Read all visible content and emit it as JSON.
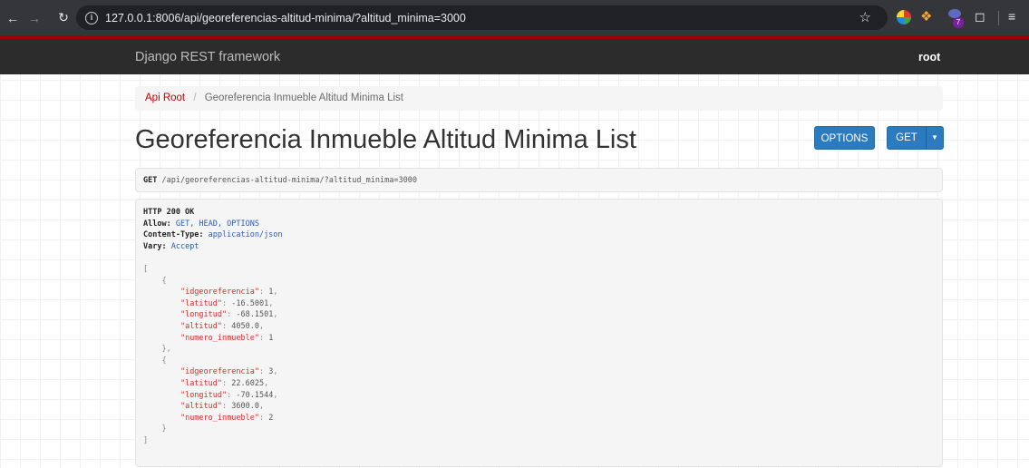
{
  "browser": {
    "url": "127.0.0.1:8006/api/georeferencias-altitud-minima/?altitud_minima=3000",
    "extension_badge": "7"
  },
  "navbar": {
    "brand": "Django REST framework",
    "user": "root"
  },
  "breadcrumb": {
    "root_label": "Api Root",
    "separator": "/",
    "current_label": "Georeferencia Inmueble Altitud Minima List"
  },
  "page": {
    "title": "Georeferencia Inmueble Altitud Minima List",
    "options_button": "OPTIONS",
    "get_button": "GET"
  },
  "request": {
    "method": "GET",
    "path": "/api/georeferencias-altitud-minima/?altitud_minima=3000"
  },
  "response": {
    "status": "HTTP 200 OK",
    "headers": [
      {
        "key": "Allow:",
        "value": "GET, HEAD, OPTIONS"
      },
      {
        "key": "Content-Type:",
        "value": "application/json"
      },
      {
        "key": "Vary:",
        "value": "Accept"
      }
    ],
    "items": [
      {
        "idgeoreferencia": "1",
        "latitud": "-16.5001",
        "longitud": "-68.1501",
        "altitud": "4050.0",
        "numero_inmueble": "1"
      },
      {
        "idgeoreferencia": "3",
        "latitud": "22.6025",
        "longitud": "-70.1544",
        "altitud": "3600.0",
        "numero_inmueble": "2"
      }
    ]
  },
  "colors": {
    "navbar_bg": "#2c2c2c",
    "navbar_accent": "#a30000",
    "link": "#c20000",
    "button": "#2c7bbf",
    "json_key": "#d0312d"
  }
}
